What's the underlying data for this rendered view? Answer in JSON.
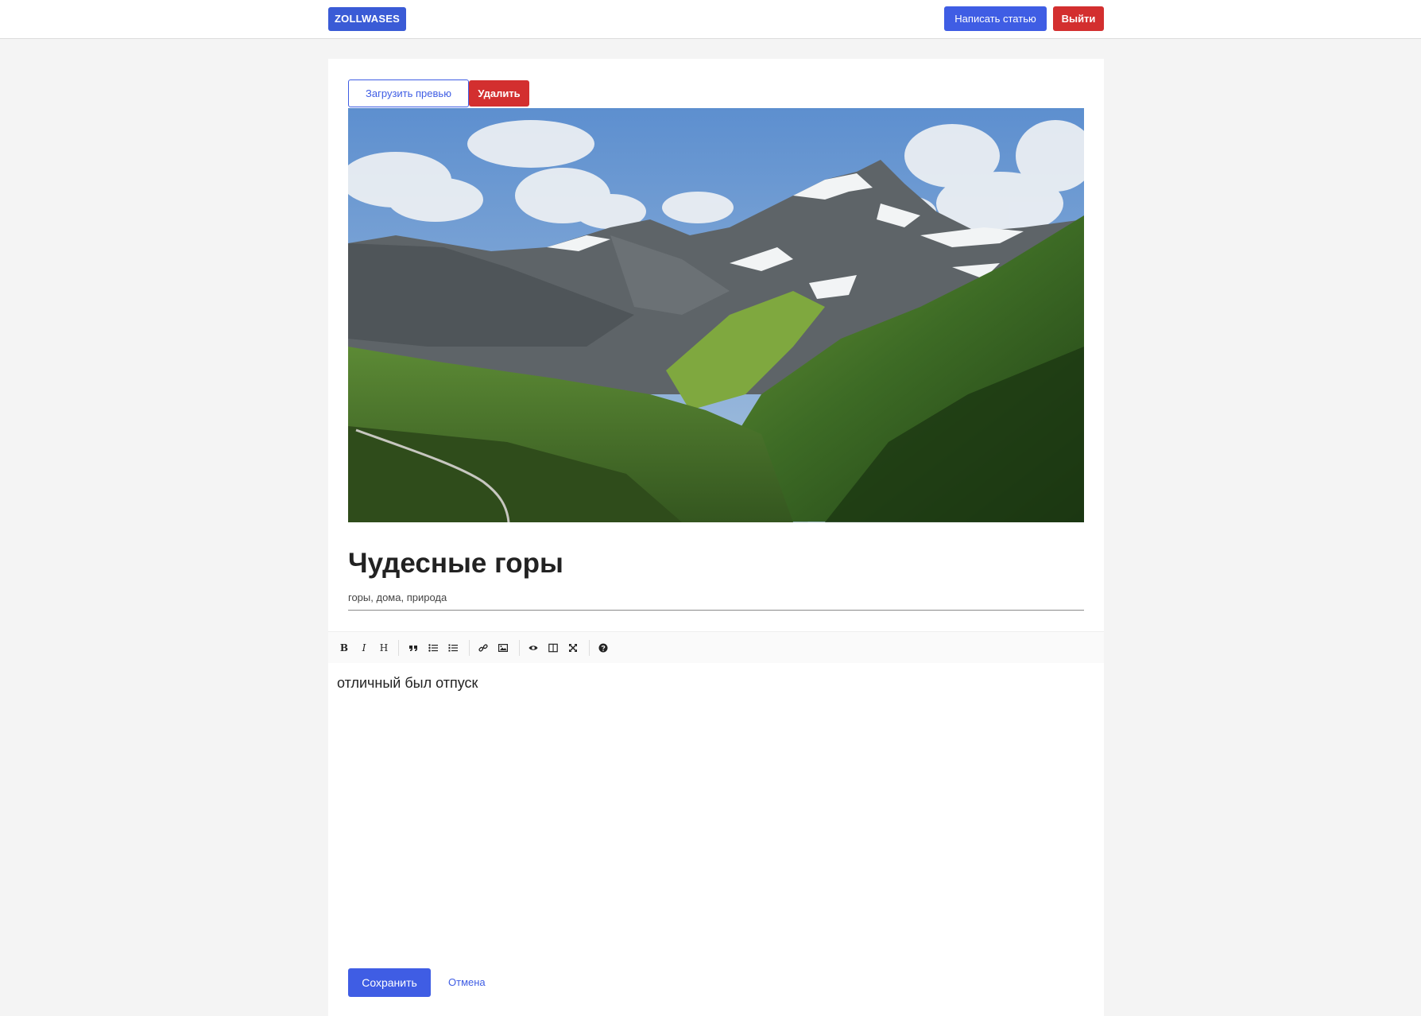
{
  "header": {
    "logo": "ZOLLWASES",
    "write_button": "Написать статью",
    "logout_button": "Выйти"
  },
  "article": {
    "upload_preview_button": "Загрузить превью",
    "delete_button": "Удалить",
    "preview_image": "mountain-valley-photo",
    "title": "Чудесные горы",
    "tags": "горы, дома, природа",
    "body": "отличный был отпуск"
  },
  "toolbar": {
    "items": [
      "bold-icon",
      "italic-icon",
      "heading-icon",
      "quote-icon",
      "unordered-list-icon",
      "ordered-list-icon",
      "link-icon",
      "image-icon",
      "preview-icon",
      "side-by-side-icon",
      "fullscreen-icon",
      "help-icon"
    ],
    "bold_glyph": "B",
    "italic_glyph": "I",
    "heading_glyph": "H"
  },
  "actions": {
    "save_button": "Сохранить",
    "cancel_link": "Отмена"
  },
  "colors": {
    "accent": "#3f5de4",
    "danger": "#d32f2f",
    "logo_bg": "#3a5bd6",
    "page_bg": "#f4f4f4"
  }
}
